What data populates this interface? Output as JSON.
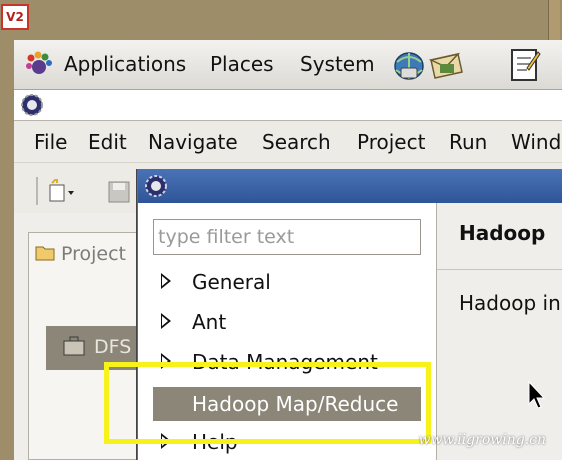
{
  "desktop": {
    "vnc_logo": "V2",
    "watermark": "www.iigrowing.cn"
  },
  "gnome_panel": {
    "menus": [
      "Applications",
      "Places",
      "System"
    ],
    "icons": [
      "gnome-foot-icon",
      "network-icon",
      "mail-icon",
      "notes-icon"
    ]
  },
  "eclipse": {
    "menu": [
      "File",
      "Edit",
      "Navigate",
      "Search",
      "Project",
      "Run",
      "Wind"
    ],
    "project_tab_label": "Project",
    "dfs_label": "DFS"
  },
  "preferences_dialog": {
    "filter_placeholder": "type filter text",
    "tree_items": [
      "General",
      "Ant",
      "Data Management",
      "Hadoop Map/Reduce",
      "Help"
    ],
    "selected_item": "Hadoop Map/Reduce",
    "page_title": "Hadoop",
    "page_body_text": "Hadoop in"
  },
  "colors": {
    "selection_bg": "#8c8679",
    "highlight": "#f6f21a",
    "dialog_titlebar": "#3a63a8",
    "desktop_bg": "#9e8d69"
  }
}
